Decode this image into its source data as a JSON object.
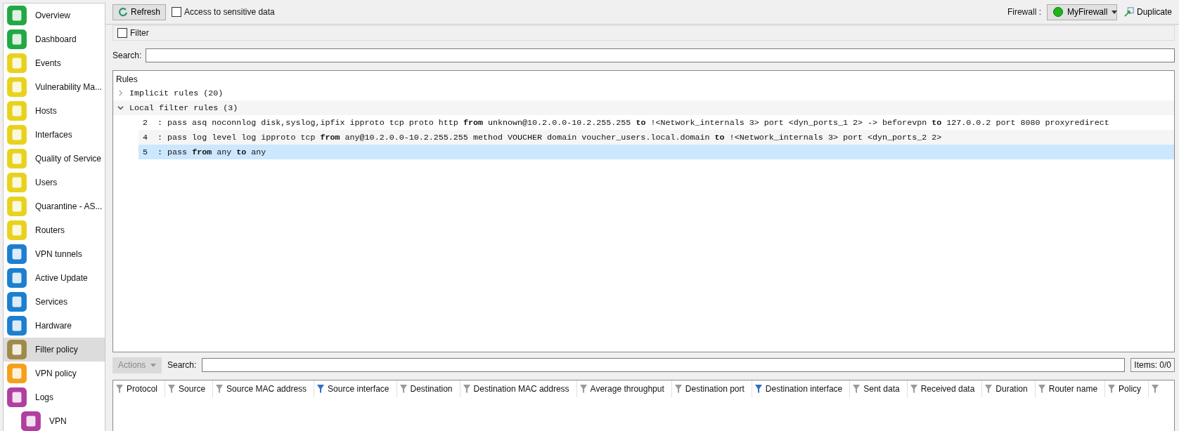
{
  "sidebar": {
    "items": [
      {
        "label": "Overview",
        "color": "#22a845",
        "selected": false
      },
      {
        "label": "Dashboard",
        "color": "#22a845",
        "selected": false
      },
      {
        "label": "Events",
        "color": "#e8d21e",
        "selected": false
      },
      {
        "label": "Vulnerability Ma...",
        "color": "#e8d21e",
        "selected": false
      },
      {
        "label": "Hosts",
        "color": "#e8d21e",
        "selected": false
      },
      {
        "label": "Interfaces",
        "color": "#e8d21e",
        "selected": false
      },
      {
        "label": "Quality of Service",
        "color": "#e8d21e",
        "selected": false
      },
      {
        "label": "Users",
        "color": "#e8d21e",
        "selected": false
      },
      {
        "label": "Quarantine - AS...",
        "color": "#e8d21e",
        "selected": false
      },
      {
        "label": "Routers",
        "color": "#e8d21e",
        "selected": false
      },
      {
        "label": "VPN tunnels",
        "color": "#1c7fcf",
        "selected": false
      },
      {
        "label": "Active Update",
        "color": "#1c7fcf",
        "selected": false
      },
      {
        "label": "Services",
        "color": "#1c7fcf",
        "selected": false
      },
      {
        "label": "Hardware",
        "color": "#1c7fcf",
        "selected": false
      },
      {
        "label": "Filter policy",
        "color": "#a08a4a",
        "selected": true
      },
      {
        "label": "VPN policy",
        "color": "#f5a01a",
        "selected": false
      },
      {
        "label": "Logs",
        "color": "#b03fa0",
        "selected": false,
        "children": [
          {
            "label": "VPN",
            "color": "#b03fa0",
            "selected": false
          }
        ]
      }
    ]
  },
  "toolbar": {
    "refresh": "Refresh",
    "sensitive": {
      "label": "Access to sensitive data",
      "checked": false
    },
    "firewall_label": "Firewall :",
    "firewall": "MyFirewall",
    "duplicate": "Duplicate"
  },
  "filter": {
    "label": "Filter",
    "checked": false
  },
  "search": {
    "label": "Search:"
  },
  "rules": {
    "title": "Rules",
    "groups": [
      {
        "label": "Implicit rules (20)",
        "expanded": false
      },
      {
        "label": "Local filter rules (3)",
        "expanded": true,
        "children": [
          {
            "number": "2",
            "text": ": pass asq noconnlog disk,syslog,ipfix ipproto tcp proto http **from** unknown@10.2.0.0-10.2.255.255 **to** !<Network_internals 3> port <dyn_ports_1 2> -> beforevpn **to** 127.0.0.2 port 8080 proxyredirect",
            "selected": false
          },
          {
            "number": "4",
            "text": ": pass log level log ipproto tcp **from** any@10.2.0.0-10.2.255.255 method VOUCHER domain voucher_users.local.domain **to** !<Network_internals 3> port <dyn_ports_2 2>",
            "selected": false
          },
          {
            "number": "5",
            "text": ": pass **from** any **to** any",
            "selected": true
          }
        ]
      }
    ]
  },
  "connections": {
    "actions": {
      "label": "Actions",
      "disabled": true
    },
    "search_label": "Search:",
    "items": "Items: 0/0",
    "columns": [
      {
        "label": "Protocol",
        "filtered": false
      },
      {
        "label": "Source",
        "filtered": false
      },
      {
        "label": "Source MAC address",
        "filtered": false
      },
      {
        "label": "Source interface",
        "filtered": true
      },
      {
        "label": "Destination",
        "filtered": false
      },
      {
        "label": "Destination MAC address",
        "filtered": false
      },
      {
        "label": "Average throughput",
        "filtered": false
      },
      {
        "label": "Destination port",
        "filtered": false
      },
      {
        "label": "Destination interface",
        "filtered": true
      },
      {
        "label": "Sent data",
        "filtered": false
      },
      {
        "label": "Received data",
        "filtered": false
      },
      {
        "label": "Duration",
        "filtered": false
      },
      {
        "label": "Router name",
        "filtered": false
      },
      {
        "label": "Policy",
        "filtered": false
      }
    ]
  }
}
